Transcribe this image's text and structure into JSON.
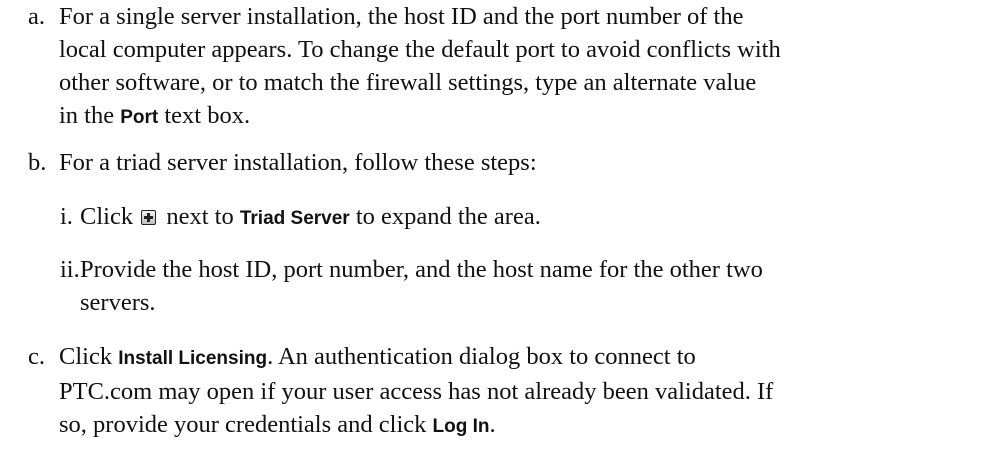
{
  "steps": {
    "a": {
      "marker": "a.",
      "lines": [
        "For a single server installation, the host ID and the port number of the",
        "local computer appears. To change the default port to avoid conflicts with",
        "other software, or to match the firewall settings, type an alternate value"
      ],
      "last_pre": "in the ",
      "ui_port": "Port",
      "last_post": " text box."
    },
    "b": {
      "marker": "b.",
      "text": "For a triad server installation, follow these steps:",
      "substeps": {
        "i": {
          "marker": "i.",
          "pre": "Click ",
          "icon": "expand-plus-icon",
          "mid": " next to ",
          "ui_triad": "Triad Server",
          "post": " to expand the area."
        },
        "ii": {
          "marker": "ii.",
          "lines": [
            "Provide the host ID, port number, and the host name for the other two",
            "servers."
          ]
        }
      }
    },
    "c": {
      "marker": "c.",
      "l1_pre": "Click ",
      "ui_install": "Install Licensing",
      "l1_post": ".  An authentication dialog box to connect to",
      "l2": "PTC.com may open if your user access has not already been validated. If",
      "l3_pre": "so, provide your credentials and click ",
      "ui_login": "Log In",
      "l3_post": "."
    }
  }
}
